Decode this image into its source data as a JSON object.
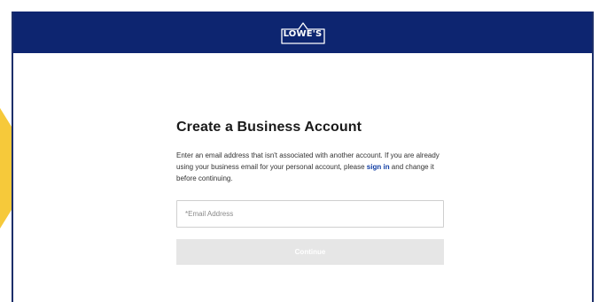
{
  "brand": {
    "logo_text": "LOWE'S",
    "header_color": "#0d2570",
    "accent_arrow_color": "#f6c93a"
  },
  "form": {
    "title": "Create a Business Account",
    "description_before_link": "Enter an email address that isn't associated with another account. If you are already using your business email for your personal account, please ",
    "link_text": "sign in",
    "description_after_link": " and change it before continuing.",
    "email_placeholder": "*Email Address",
    "email_value": "",
    "continue_label": "Continue",
    "continue_disabled": true
  }
}
